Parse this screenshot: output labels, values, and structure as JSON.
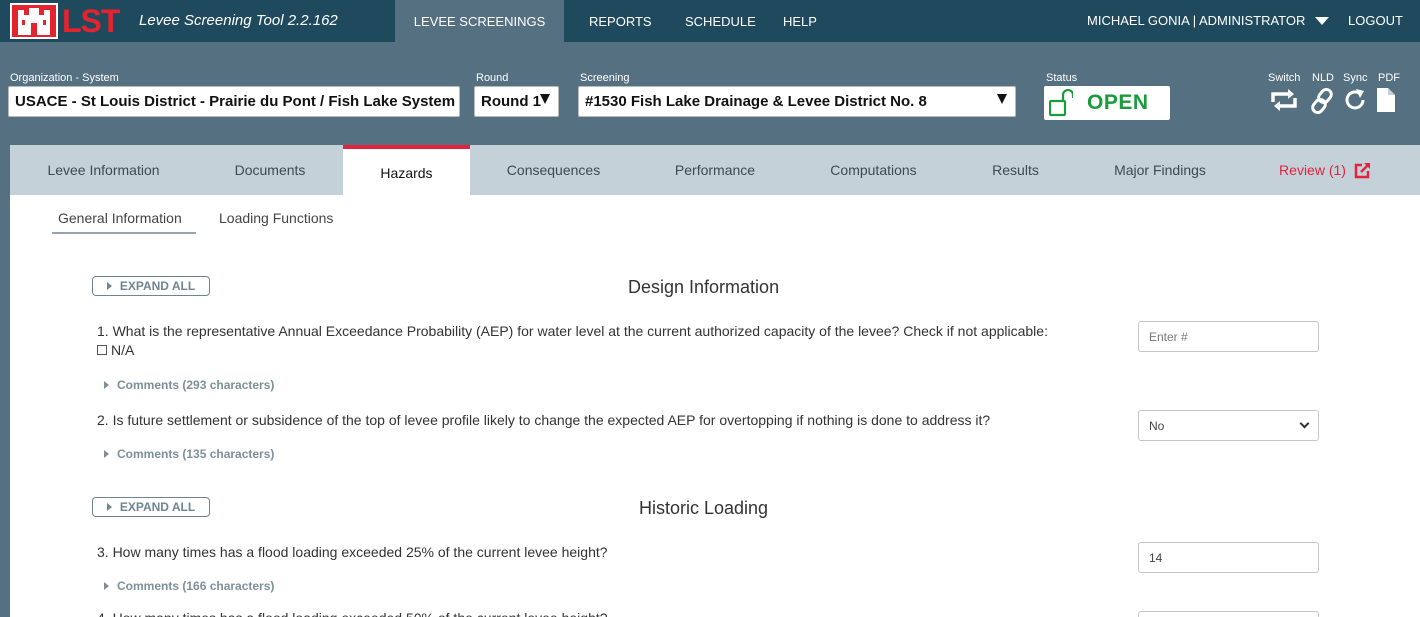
{
  "app": {
    "logo_text": "LST",
    "title": "Levee Screening Tool 2.2.162"
  },
  "nav": {
    "items": [
      "LEVEE SCREENINGS",
      "REPORTS",
      "SCHEDULE",
      "HELP"
    ],
    "active": "LEVEE SCREENINGS",
    "user": "MICHAEL GONIA | ADMINISTRATOR",
    "logout": "LOGOUT"
  },
  "header": {
    "org_label": "Organization - System",
    "org_value": "USACE - St Louis District - Prairie du Pont / Fish Lake System",
    "round_label": "Round",
    "round_value": "Round 1",
    "screening_label": "Screening",
    "screening_value": "#1530 Fish Lake Drainage & Levee District No. 8",
    "status_label": "Status",
    "status_value": "OPEN",
    "status_color": "#1a9b3c",
    "tools": [
      {
        "label": "Switch",
        "icon": "switch-icon"
      },
      {
        "label": "NLD",
        "icon": "link-icon"
      },
      {
        "label": "Sync",
        "icon": "sync-icon"
      },
      {
        "label": "PDF",
        "icon": "pdf-icon"
      }
    ]
  },
  "tabs": {
    "items": [
      "Levee Information",
      "Documents",
      "Hazards",
      "Consequences",
      "Performance",
      "Computations",
      "Results",
      "Major Findings",
      "Review (1)"
    ],
    "active": "Hazards",
    "accent": "#e3233e"
  },
  "subtabs": {
    "items": [
      "General Information",
      "Loading Functions"
    ],
    "active": "General Information"
  },
  "sections": [
    {
      "expand_label": "EXPAND ALL",
      "title": "Design Information",
      "questions": [
        {
          "text": "1. What is the representative Annual Exceedance Probability (AEP) for water level at the current authorized capacity of the levee? Check if not applicable:",
          "na_label": "N/A",
          "comments": "Comments (293 characters)",
          "answer_placeholder": "Enter #",
          "answer": ""
        },
        {
          "text": "2. Is future settlement or subsidence of the top of levee profile likely to change the expected AEP for overtopping if nothing is done to address it?",
          "comments": "Comments (135 characters)",
          "answer": "No"
        }
      ]
    },
    {
      "expand_label": "EXPAND ALL",
      "title": "Historic Loading",
      "questions": [
        {
          "text": "3. How many times has a flood loading exceeded 25% of the current levee height?",
          "comments": "Comments (166 characters)",
          "answer": "14"
        },
        {
          "text": "4. How many times has a flood loading exceeded 50% of the current levee height?"
        }
      ]
    }
  ]
}
